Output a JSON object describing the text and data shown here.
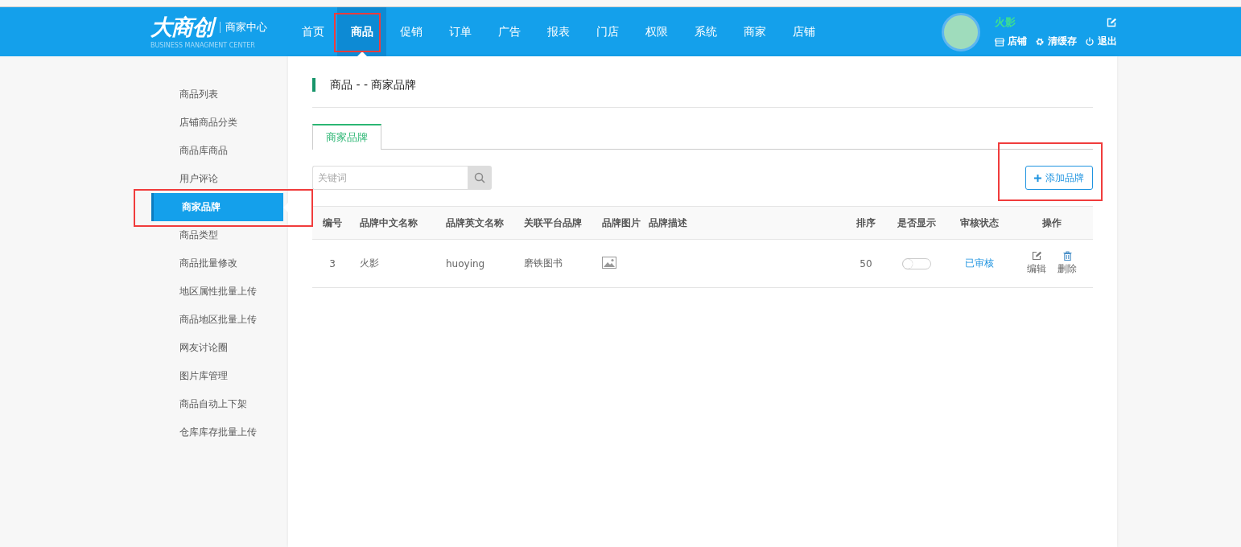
{
  "header": {
    "logo": "大商创",
    "logo_subtitle": "商家中心",
    "logo_tagline": "BUSINESS MANAGMENT CENTER",
    "nav": [
      {
        "label": "首页",
        "selected": false,
        "highlighted": false
      },
      {
        "label": "商品",
        "selected": true,
        "highlighted": true
      },
      {
        "label": "促销",
        "selected": false,
        "highlighted": false
      },
      {
        "label": "订单",
        "selected": false,
        "highlighted": false
      },
      {
        "label": "广告",
        "selected": false,
        "highlighted": false
      },
      {
        "label": "报表",
        "selected": false,
        "highlighted": false
      },
      {
        "label": "门店",
        "selected": false,
        "highlighted": false
      },
      {
        "label": "权限",
        "selected": false,
        "highlighted": false
      },
      {
        "label": "系统",
        "selected": false,
        "highlighted": false
      },
      {
        "label": "商家",
        "selected": false,
        "highlighted": false
      },
      {
        "label": "店铺",
        "selected": false,
        "highlighted": false
      }
    ],
    "user": {
      "name": "火影",
      "links": [
        {
          "label": "店铺",
          "kind": "store"
        },
        {
          "label": "清缓存",
          "kind": "gear"
        },
        {
          "label": "退出",
          "kind": "power"
        }
      ]
    }
  },
  "sidebar": {
    "items": [
      {
        "label": "商品列表",
        "selected": false,
        "highlighted": false
      },
      {
        "label": "店铺商品分类",
        "selected": false,
        "highlighted": false
      },
      {
        "label": "商品库商品",
        "selected": false,
        "highlighted": false
      },
      {
        "label": "用户评论",
        "selected": false,
        "highlighted": false
      },
      {
        "label": "商家品牌",
        "selected": true,
        "highlighted": true
      },
      {
        "label": "商品类型",
        "selected": false,
        "highlighted": false
      },
      {
        "label": "商品批量修改",
        "selected": false,
        "highlighted": false
      },
      {
        "label": "地区属性批量上传",
        "selected": false,
        "highlighted": false
      },
      {
        "label": "商品地区批量上传",
        "selected": false,
        "highlighted": false
      },
      {
        "label": "网友讨论圈",
        "selected": false,
        "highlighted": false
      },
      {
        "label": "图片库管理",
        "selected": false,
        "highlighted": false
      },
      {
        "label": "商品自动上下架",
        "selected": false,
        "highlighted": false
      },
      {
        "label": "仓库库存批量上传",
        "selected": false,
        "highlighted": false
      }
    ]
  },
  "main": {
    "title": "商品 - - 商家品牌",
    "tabs": [
      {
        "label": "商家品牌",
        "selected": true
      }
    ],
    "search": {
      "placeholder": "关键词"
    },
    "add_button": {
      "label": "添加品牌",
      "highlighted": true
    },
    "table": {
      "columns": [
        "编号",
        "品牌中文名称",
        "品牌英文名称",
        "关联平台品牌",
        "品牌图片",
        "品牌描述",
        "排序",
        "是否显示",
        "审核状态",
        "操作"
      ],
      "rows": [
        {
          "id": "3",
          "name_cn": "火影",
          "name_en": "huoying",
          "platform_brand": "磨铁图书",
          "sort": "50",
          "display_on": false,
          "status": "已审核",
          "actions": [
            {
              "label": "编辑",
              "kind": "edit"
            },
            {
              "label": "删除",
              "kind": "delete"
            }
          ]
        }
      ]
    }
  }
}
